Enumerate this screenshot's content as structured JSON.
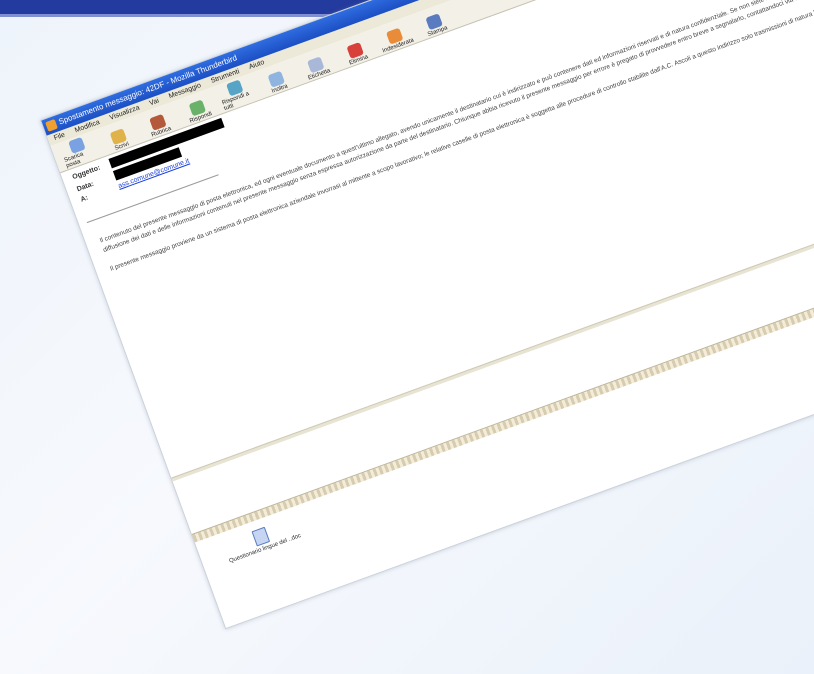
{
  "window": {
    "title": "Spostamento messaggio: 42DF - Mozilla Thunderbird"
  },
  "menu": [
    "File",
    "Modifica",
    "Visualizza",
    "Vai",
    "Messaggio",
    "Strumenti",
    "Aiuto"
  ],
  "toolbar": [
    {
      "label": "Scarica posta",
      "icon": "inbox-icon"
    },
    {
      "label": "Scrivi",
      "icon": "pencil-icon"
    },
    {
      "label": "Rubrica",
      "icon": "address-book-icon"
    },
    {
      "label": "Rispondi",
      "icon": "reply-icon"
    },
    {
      "label": "Rispondi a tutti",
      "icon": "reply-all-icon"
    },
    {
      "label": "Inoltra",
      "icon": "forward-icon"
    },
    {
      "label": "Etichetta",
      "icon": "tag-icon"
    },
    {
      "label": "Elimina",
      "icon": "delete-icon"
    },
    {
      "label": "Indesiderata",
      "icon": "junk-icon"
    },
    {
      "label": "Stampa",
      "icon": "print-icon"
    }
  ],
  "header": {
    "from_label": "Oggetto:",
    "date_label": "Data:",
    "to_label": "A:",
    "link_text": "ass.comune@comune.it"
  },
  "body": {
    "paragraph1": "Il contenuto del presente messaggio di posta elettronica, ed ogni eventuale documento a quest'ultimo allegato, avendo unicamente il destinatario cui è indirizzato e può contenere dati ed informazioni riservati e di natura confidenziale. Se non siete la persona cui è indirizzato, si informa che la diffusione dei dati e delle informazioni contenuti nel presente messaggio senza espressa autorizzazione da parte del destinatario. Chiunque abbia ricevuto il presente messaggio per errore è pregato di provvedere entro breve a segnalarlo, contattandoci via telefono, fax o e-mail.",
    "paragraph2": "Il presente messaggio proviene da un sistema di posta elettronica aziendale invorrasi al mittente a scopo lavorativo; le relative caselle di posta elettronica è soggetta alle procedure di controllo stabilite dall'A.C. Ascoli a questo indirizzo solo trasmissioni di natura lavorativa, grazie."
  },
  "attachment": {
    "label": "Questionario lingue del ..doc"
  },
  "colors": {
    "top_bar": "#233a9e",
    "titlebar": "#1c4fc4",
    "background": "#eef4fb"
  }
}
